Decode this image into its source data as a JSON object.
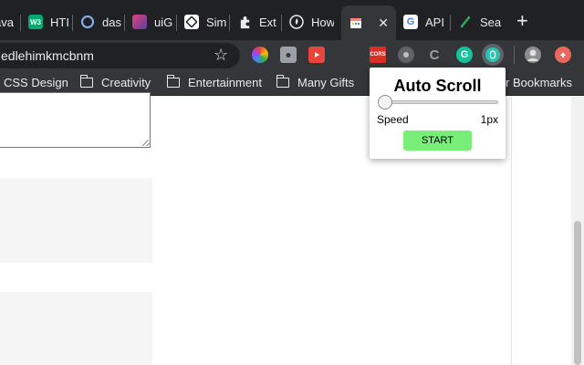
{
  "browser": {
    "tabs": [
      {
        "label": "ava",
        "favicon_text": "",
        "favicon_color": "#202124"
      },
      {
        "label": "HTI",
        "favicon_text": "W3",
        "favicon_color": "#04aa6d"
      },
      {
        "label": "das",
        "favicon_text": "",
        "favicon_color": "#202124"
      },
      {
        "label": "uiG",
        "favicon_text": "",
        "favicon_color": "#b43b7c"
      },
      {
        "label": "Sim",
        "favicon_text": "",
        "favicon_color": "#ffffff"
      },
      {
        "label": "Ext",
        "favicon_text": "",
        "favicon_color": "#202124"
      },
      {
        "label": "How",
        "favicon_text": "",
        "favicon_color": "#202124"
      },
      {
        "label": "",
        "favicon_text": "",
        "favicon_color": "#f28b82",
        "active": true
      },
      {
        "label": "API",
        "favicon_text": "G",
        "favicon_color": "#ffffff"
      },
      {
        "label": "Sea",
        "favicon_text": "",
        "favicon_color": "#202124"
      }
    ],
    "active_close_icon": "✕",
    "new_tab_icon": "+",
    "url": "edlehimkmcbnm",
    "bookmark_star_icon": "☆",
    "extensions": [
      {
        "name": "color-wheel-icon",
        "text": "",
        "color": "#e8453c"
      },
      {
        "name": "camera-icon",
        "text": "",
        "color": "#9aa0a6"
      },
      {
        "name": "screen-record-icon",
        "text": "",
        "color": "#e8453c"
      },
      {
        "name": "cors-icon",
        "text": "CORS",
        "color": "#d93025"
      },
      {
        "name": "unicorn-icon",
        "text": "",
        "color": "#9aa0a6"
      },
      {
        "name": "code-icon",
        "text": "C",
        "color": "#5f6368"
      },
      {
        "name": "grammarly-icon",
        "text": "G",
        "color": "#15c39a"
      },
      {
        "name": "auto-scroll-icon",
        "text": "",
        "color": "#2bc4b0"
      },
      {
        "name": "profile-avatar-icon",
        "text": "",
        "color": "#8d8d8d"
      },
      {
        "name": "update-arrow-icon",
        "text": "",
        "color": "#ee675c"
      }
    ],
    "bookmarks": [
      {
        "label": "CSS Design",
        "folder": false
      },
      {
        "label": "Creativity",
        "folder": true
      },
      {
        "label": "Entertainment",
        "folder": true
      },
      {
        "label": "Many Gifts",
        "folder": true
      },
      {
        "label": "r Bookmarks",
        "folder": false
      }
    ]
  },
  "popup": {
    "title": "Auto Scroll",
    "speed_label": "Speed",
    "speed_value": "1px",
    "start_label": "START",
    "slider_value": 0,
    "accent_color": "#77ee77"
  }
}
